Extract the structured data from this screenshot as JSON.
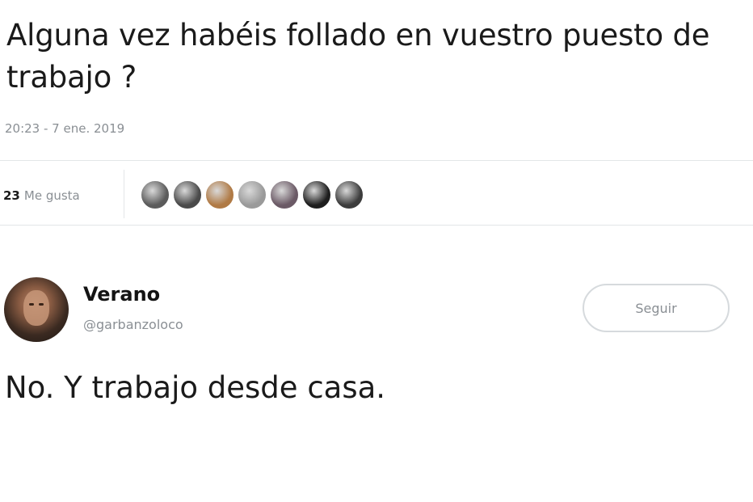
{
  "tweet": {
    "text": "Alguna vez habéis follado en vuestro puesto de trabajo ?",
    "timestamp": "20:23 - 7 ene. 2019",
    "likes_count": "23",
    "likes_label": "Me gusta",
    "liker_avatars": [
      {
        "icon": "liker-avatar-1",
        "color": "#5b5b5b"
      },
      {
        "icon": "liker-avatar-2",
        "color": "#4a4a4a"
      },
      {
        "icon": "liker-avatar-3",
        "color": "#b07a45"
      },
      {
        "icon": "liker-avatar-4",
        "color": "#9a9a9a"
      },
      {
        "icon": "liker-avatar-5",
        "color": "#6b5a66"
      },
      {
        "icon": "liker-avatar-6",
        "color": "#1e1e1e"
      },
      {
        "icon": "liker-avatar-7",
        "color": "#3c3c3c"
      }
    ]
  },
  "reply": {
    "user_name": "Verano",
    "user_handle": "@garbanzoloco",
    "follow_label": "Seguir",
    "text": "No. Y trabajo desde casa."
  }
}
